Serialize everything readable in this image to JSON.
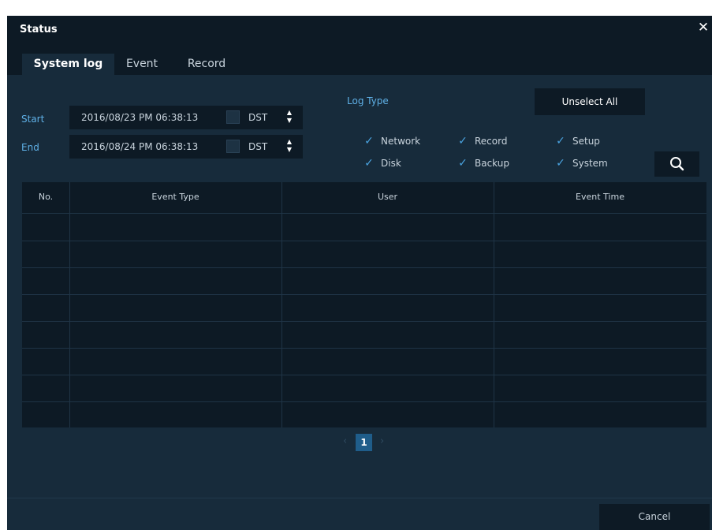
{
  "window": {
    "title": "Status",
    "close_symbol": "✕"
  },
  "tabs": [
    {
      "label": "System log",
      "active": true
    },
    {
      "label": "Event",
      "active": false
    },
    {
      "label": "Record",
      "active": false
    }
  ],
  "range": {
    "start_label": "Start",
    "start_value": "2016/08/23 PM 06:38:13",
    "end_label": "End",
    "end_value": "2016/08/24 PM 06:38:13",
    "dst_label": "DST",
    "start_dst_checked": false,
    "end_dst_checked": false
  },
  "log_type": {
    "label": "Log Type",
    "unselect_all_label": "Unselect All",
    "options": [
      {
        "label": "Network",
        "checked": true
      },
      {
        "label": "Record",
        "checked": true
      },
      {
        "label": "Setup",
        "checked": true
      },
      {
        "label": "Disk",
        "checked": true
      },
      {
        "label": "Backup",
        "checked": true
      },
      {
        "label": "System",
        "checked": true
      }
    ],
    "check_mark": "✓",
    "search_icon": "search-icon"
  },
  "table": {
    "columns": [
      "No.",
      "Event Type",
      "User",
      "Event Time"
    ],
    "rows": []
  },
  "pagination": {
    "prev": "‹",
    "current": "1",
    "next": "›"
  },
  "footer": {
    "cancel_label": "Cancel"
  },
  "colors": {
    "panel": "#172b3b",
    "dark": "#0d1a25",
    "accent": "#4aa3e0",
    "label": "#5fb0e6"
  }
}
